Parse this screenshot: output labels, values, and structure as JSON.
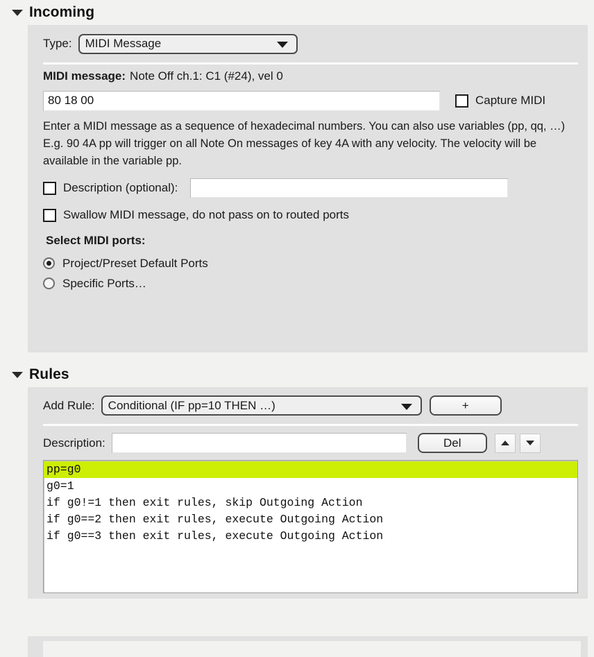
{
  "incoming": {
    "section_label": "Incoming",
    "type_label": "Type:",
    "type_value": "MIDI Message",
    "midi_message_label": "MIDI message:",
    "midi_message_value": "Note Off ch.1: C1 (#24), vel 0",
    "midi_hex_value": "80 18 00",
    "capture_midi_label": "Capture MIDI",
    "help_text": "Enter a MIDI message as a sequence of hexadecimal numbers. You can also use variables (pp, qq, …) E.g. 90 4A pp will trigger on all Note On messages of key 4A with any velocity. The velocity will be available in the variable pp.",
    "description_label": "Description (optional):",
    "description_value": "",
    "swallow_label": "Swallow MIDI message, do not pass on to routed ports",
    "select_ports_label": "Select MIDI ports:",
    "port_option_default": "Project/Preset Default Ports",
    "port_option_specific": "Specific Ports…"
  },
  "rules": {
    "section_label": "Rules",
    "add_rule_label": "Add Rule:",
    "add_rule_value": "Conditional (IF pp=10 THEN …)",
    "add_button_label": "+",
    "description_label": "Description:",
    "description_value": "",
    "del_button_label": "Del",
    "list": [
      {
        "text": "pp=g0",
        "selected": true
      },
      {
        "text": "g0=1",
        "selected": false
      },
      {
        "text": "if g0!=1 then exit rules, skip Outgoing Action",
        "selected": false
      },
      {
        "text": "if g0==2 then exit rules, execute Outgoing Action",
        "selected": false
      },
      {
        "text": "if g0==3 then exit rules, execute Outgoing Action",
        "selected": false
      }
    ]
  },
  "colors": {
    "window_bg": "#f2f2f1",
    "panel_bg": "#e1e1e1",
    "selection": "#cdee05",
    "field_bg": "#ffffff",
    "text": "#1a1a1a"
  }
}
